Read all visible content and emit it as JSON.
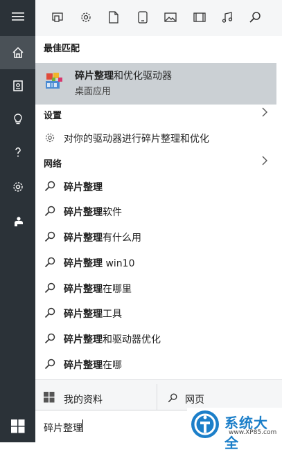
{
  "filters": [
    {
      "icon": "apps-icon"
    },
    {
      "icon": "settings-icon"
    },
    {
      "icon": "documents-icon"
    },
    {
      "icon": "folders-icon"
    },
    {
      "icon": "photos-icon"
    },
    {
      "icon": "videos-icon"
    },
    {
      "icon": "music-icon"
    },
    {
      "icon": "search-icon"
    }
  ],
  "rail": [
    {
      "icon": "hamburger-icon"
    },
    {
      "icon": "home-icon"
    },
    {
      "icon": "notebook-icon"
    },
    {
      "icon": "lightbulb-icon"
    },
    {
      "icon": "help-icon"
    },
    {
      "icon": "settings-icon"
    },
    {
      "icon": "feedback-icon"
    },
    {
      "icon": "windows-icon"
    }
  ],
  "sections": {
    "best_match": "最佳匹配",
    "settings": "设置",
    "web": "网络"
  },
  "best_match": {
    "title_bold": "碎片整理",
    "title_rest": "和优化驱动器",
    "subtitle": "桌面应用"
  },
  "settings_item": {
    "label": "对你的驱动器进行碎片整理和优化"
  },
  "web_results": [
    {
      "bold": "碎片整理",
      "rest": ""
    },
    {
      "bold": "碎片整理",
      "rest": "软件"
    },
    {
      "bold": "碎片整理",
      "rest": "有什么用"
    },
    {
      "bold": "碎片整理",
      "rest": " win10"
    },
    {
      "bold": "碎片整理",
      "rest": "在哪里"
    },
    {
      "bold": "碎片整理",
      "rest": "工具"
    },
    {
      "bold": "碎片整理",
      "rest": "和驱动器优化"
    },
    {
      "bold": "碎片整理",
      "rest": "在哪"
    }
  ],
  "bottom": {
    "my_stuff": "我的资料",
    "web": "网页"
  },
  "search": {
    "value": "碎片整理"
  },
  "watermark": {
    "name": "系统大全",
    "url": "www.XP85.com"
  },
  "colors": {
    "rail": "#2b3238",
    "best_match_bg": "#cbd0d4",
    "logo_blue": "#1c7fc9"
  }
}
